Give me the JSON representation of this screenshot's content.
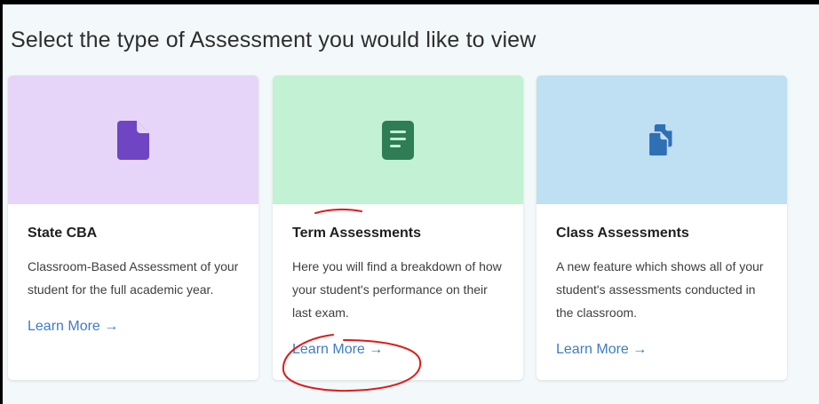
{
  "page": {
    "heading": "Select the type of Assessment you would like to view"
  },
  "cards": [
    {
      "title": "State CBA",
      "description": "Classroom-Based Assessment of your student for the full academic year.",
      "link": "Learn More →",
      "banner_color": "#e6d5f9",
      "icon": "document-icon",
      "icon_color": "#6f45c4"
    },
    {
      "title": "Term Assessments",
      "description": "Here you will find a breakdown of how your student's performance on their last exam.",
      "link": "Learn More →",
      "banner_color": "#c2f1d4",
      "icon": "document-lines-icon",
      "icon_color": "#2f7d55"
    },
    {
      "title": "Class Assessments",
      "description": "A new feature which shows all of your student's assessments conducted in the classroom.",
      "link": "Learn More →",
      "banner_color": "#bfdff3",
      "icon": "documents-copy-icon",
      "icon_color": "#2f6fb4"
    }
  ],
  "theme": {
    "link_color": "#3d7cc7",
    "annotation_color": "#e01b1b"
  }
}
